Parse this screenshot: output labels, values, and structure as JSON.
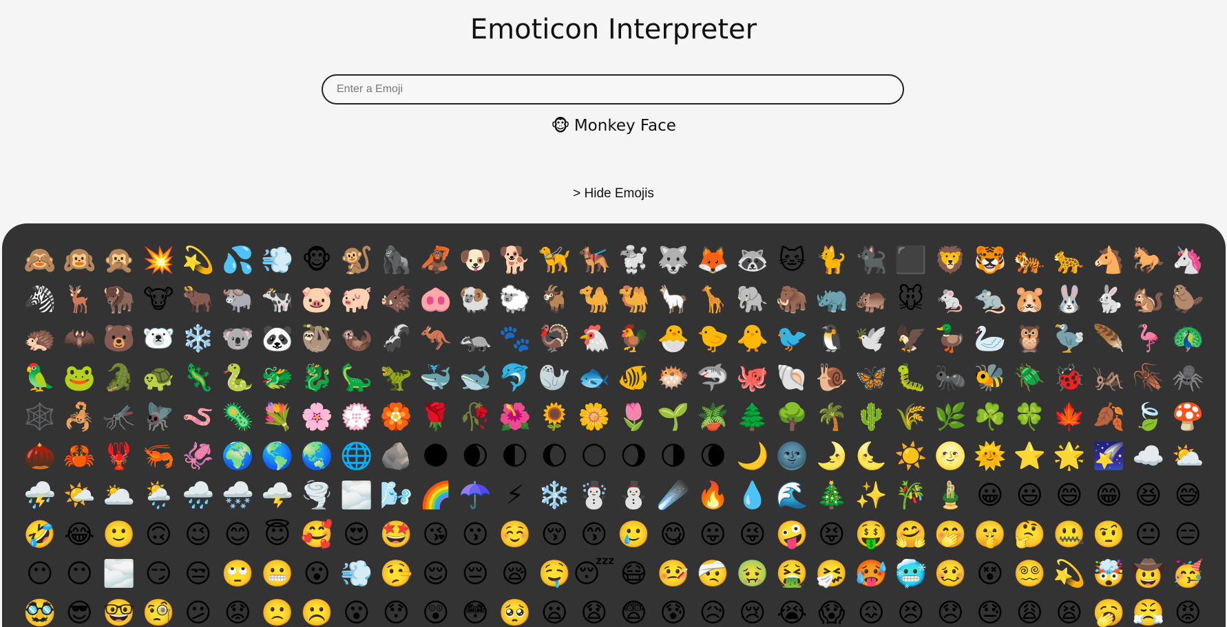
{
  "app": {
    "title": "Emoticon Interpreter"
  },
  "search": {
    "placeholder": "Enter a Emoji",
    "value": ""
  },
  "result": {
    "emoji": "🐵",
    "name": "Monkey Face"
  },
  "toggle": {
    "label": "> Hide Emojis"
  },
  "colors": {
    "page_background": "#f5f5f5",
    "panel_background": "#333333",
    "text": "#111111"
  },
  "emojis": [
    "🙈",
    "🙉",
    "🙊",
    "💥",
    "💫",
    "💦",
    "💨",
    "🐵",
    "🐒",
    "🦍",
    "🦧",
    "🐶",
    "🐕",
    "🦮",
    "🐕‍🦺",
    "🐩",
    "🐺",
    "🦊",
    "🦝",
    "🐱",
    "🐈",
    "🐈‍⬛",
    "⬛",
    "🦁",
    "🐯",
    "🐅",
    "🐆",
    "🐴",
    "🐎",
    "🦄",
    "🦓",
    "🦌",
    "🦬",
    "🐮",
    "🐂",
    "🐃",
    "🐄",
    "🐷",
    "🐖",
    "🐗",
    "🐽",
    "🐏",
    "🐑",
    "🐐",
    "🐪",
    "🐫",
    "🦙",
    "🦒",
    "🐘",
    "🦣",
    "🦏",
    "🦛",
    "🐭",
    "🐁",
    "🐀",
    "🐹",
    "🐰",
    "🐇",
    "🐿️",
    "🦫",
    "🦔",
    "🦇",
    "🐻",
    "🐻‍❄️",
    "❄️",
    "🐨",
    "🐼",
    "🦥",
    "🦦",
    "🦨",
    "🦘",
    "🦡",
    "🐾",
    "🦃",
    "🐔",
    "🐓",
    "🐣",
    "🐤",
    "🐥",
    "🐦",
    "🐧",
    "🕊️",
    "🦅",
    "🦆",
    "🦢",
    "🦉",
    "🦤",
    "🪶",
    "🦩",
    "🦚",
    "🦜",
    "🐸",
    "🐊",
    "🐢",
    "🦎",
    "🐍",
    "🐲",
    "🐉",
    "🦕",
    "🦖",
    "🐳",
    "🐋",
    "🐬",
    "🦭",
    "🐟",
    "🐠",
    "🐡",
    "🦈",
    "🐙",
    "🐚",
    "🐌",
    "🦋",
    "🐛",
    "🐜",
    "🐝",
    "🪲",
    "🐞",
    "🦗",
    "🪳",
    "🕷️",
    "🕸️",
    "🦂",
    "🦟",
    "🪰",
    "🪱",
    "🦠",
    "💐",
    "🌸",
    "💮",
    "🏵️",
    "🌹",
    "🥀",
    "🌺",
    "🌻",
    "🌼",
    "🌷",
    "🌱",
    "🪴",
    "🌲",
    "🌳",
    "🌴",
    "🌵",
    "🌾",
    "🌿",
    "☘️",
    "🍀",
    "🍁",
    "🍂",
    "🍃",
    "🍄",
    "🌰",
    "🦀",
    "🦞",
    "🦐",
    "🦑",
    "🌍",
    "🌎",
    "🌏",
    "🌐",
    "🪨",
    "🌑",
    "🌒",
    "🌓",
    "🌔",
    "🌕",
    "🌖",
    "🌗",
    "🌘",
    "🌙",
    "🌚",
    "🌛",
    "🌜",
    "☀️",
    "🌝",
    "🌞",
    "⭐",
    "🌟",
    "🌠",
    "☁️",
    "⛅",
    "⛈️",
    "🌤️",
    "🌥️",
    "🌦️",
    "🌧️",
    "🌨️",
    "🌩️",
    "🌪️",
    "🌫️",
    "🌬️",
    "🌈",
    "☂️",
    "⚡",
    "❄️",
    "☃️",
    "⛄",
    "☄️",
    "🔥",
    "💧",
    "🌊",
    "🎄",
    "✨",
    "🎋",
    "🎍",
    "😀",
    "😃",
    "😄",
    "😁",
    "😆",
    "😅",
    "🤣",
    "😂",
    "🙂",
    "🙃",
    "😉",
    "😊",
    "😇",
    "🥰",
    "😍",
    "🤩",
    "😘",
    "😗",
    "☺️",
    "😚",
    "😙",
    "🥲",
    "😋",
    "😛",
    "😜",
    "🤪",
    "😝",
    "🤑",
    "🤗",
    "🤭",
    "🤫",
    "🤔",
    "🤐",
    "🤨",
    "😐",
    "😑",
    "😶",
    "😶",
    "🌫️",
    "😏",
    "😒",
    "🙄",
    "😬",
    "😮",
    "💨",
    "🤥",
    "😌",
    "😔",
    "😪",
    "🤤",
    "😴",
    "😷",
    "🤒",
    "🤕",
    "🤢",
    "🤮",
    "🤧",
    "🥵",
    "🥶",
    "🥴",
    "😵",
    "😵‍💫",
    "💫",
    "🤯",
    "🤠",
    "🥳",
    "🥸",
    "😎",
    "🤓",
    "🧐",
    "😕",
    "😟",
    "🙁",
    "☹️",
    "😮",
    "😯",
    "😲",
    "😳",
    "🥺",
    "😦",
    "😧",
    "😨",
    "😰",
    "😥",
    "😢",
    "😭",
    "😱",
    "😖",
    "😣",
    "😞",
    "😓",
    "😩",
    "😫",
    "🥱",
    "😤",
    "😡"
  ]
}
